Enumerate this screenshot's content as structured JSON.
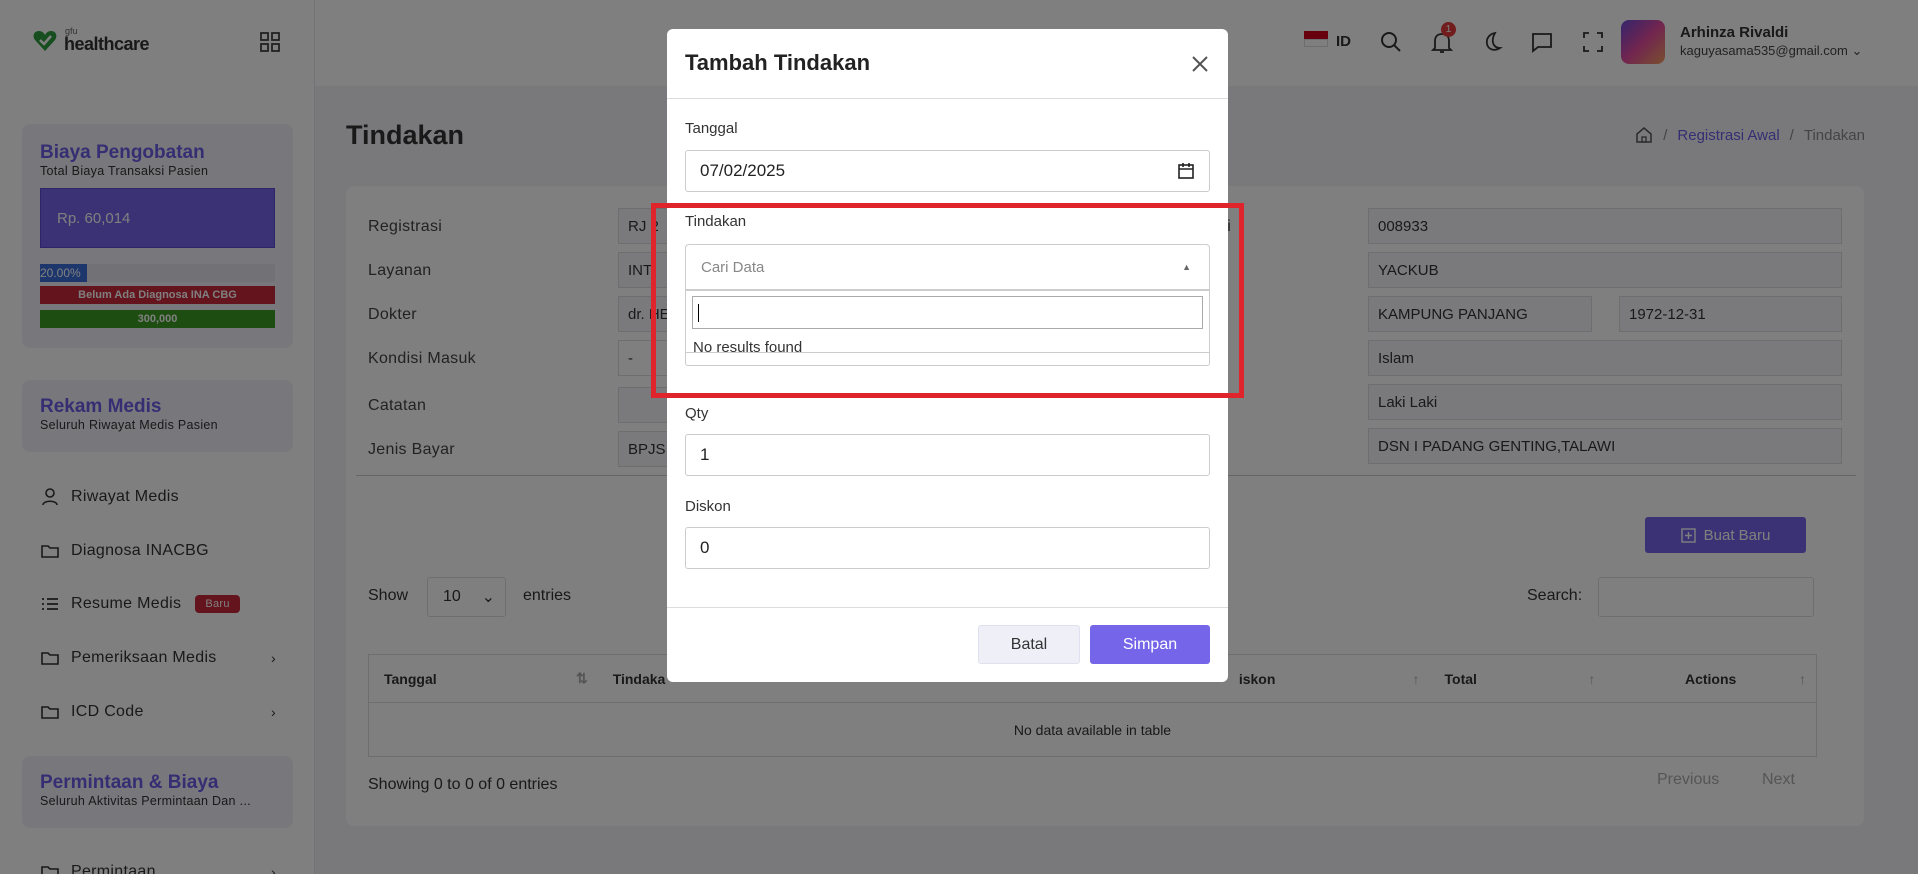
{
  "brand": {
    "sup": "gfu",
    "name": "healthcare"
  },
  "sidebar": {
    "biaya": {
      "title": "Biaya Pengobatan",
      "subtitle": "Total Biaya Transaksi Pasien",
      "amount": "Rp. 60,014",
      "percent_label": "20.00%",
      "percent_value": 0.2,
      "diagnosa_status": "Belum Ada Diagnosa INA CBG",
      "limit": "300,000"
    },
    "rekam": {
      "title": "Rekam Medis",
      "subtitle": "Seluruh Riwayat Medis Pasien"
    },
    "items": [
      {
        "label": "Riwayat Medis",
        "icon": "user-icon"
      },
      {
        "label": "Diagnosa INACBG",
        "icon": "folder-icon"
      },
      {
        "label": "Resume Medis",
        "icon": "list-icon",
        "badge": "Baru"
      },
      {
        "label": "Pemeriksaan Medis",
        "icon": "folder-icon"
      },
      {
        "label": "ICD Code",
        "icon": "folder-icon"
      }
    ],
    "permintaan": {
      "title": "Permintaan & Biaya",
      "subtitle": "Seluruh Aktivitas Permintaan Dan ..."
    },
    "cut_item": {
      "label": "Permintaan"
    }
  },
  "header": {
    "lang": "ID",
    "notif_count": "1",
    "user_name": "Arhinza Rivaldi",
    "user_email": "kaguyasama535@gmail.com"
  },
  "page": {
    "title": "Tindakan",
    "breadcrumb": [
      "Registrasi Awal",
      "Tindakan"
    ]
  },
  "form": {
    "labels": [
      "Registrasi",
      "Layanan",
      "Dokter",
      "Kondisi Masuk",
      "Catatan",
      "Jenis Bayar"
    ],
    "left_values": [
      "RJ 2",
      "INT",
      "dr. HE",
      "-",
      "",
      "BPJS"
    ],
    "right_values": {
      "rm": "008933",
      "nama": "YACKUB",
      "tempat": "KAMPUNG PANJANG",
      "tgl_lahir": "1972-12-31",
      "agama": "Islam",
      "kelamin": "Laki Laki",
      "alamat": "DSN I PADANG GENTING,TALAWI"
    },
    "right_label_fragment": "di"
  },
  "table_controls": {
    "buat_baru": "Buat Baru",
    "show": "Show",
    "entries_value": "10",
    "entries": "entries",
    "search_label": "Search:"
  },
  "table": {
    "headers": [
      "Tanggal",
      "Tindaka",
      "",
      "",
      "iskon",
      "Total",
      "Actions"
    ],
    "empty": "No data available in table",
    "showing": "Showing 0 to 0 of 0 entries",
    "prev": "Previous",
    "next": "Next"
  },
  "modal": {
    "title": "Tambah Tindakan",
    "tanggal_label": "Tanggal",
    "tanggal_value": "07/02/2025",
    "tindakan_label": "Tindakan",
    "tindakan_placeholder": "Cari Data",
    "no_results": "No results found",
    "qty_label": "Qty",
    "qty_value": "1",
    "diskon_label": "Diskon",
    "diskon_value": "0",
    "batal": "Batal",
    "simpan": "Simpan"
  },
  "colors": {
    "accent": "#7565e8",
    "highlight": "#e0242b",
    "danger": "#c8293a",
    "success": "#3d9b25"
  }
}
